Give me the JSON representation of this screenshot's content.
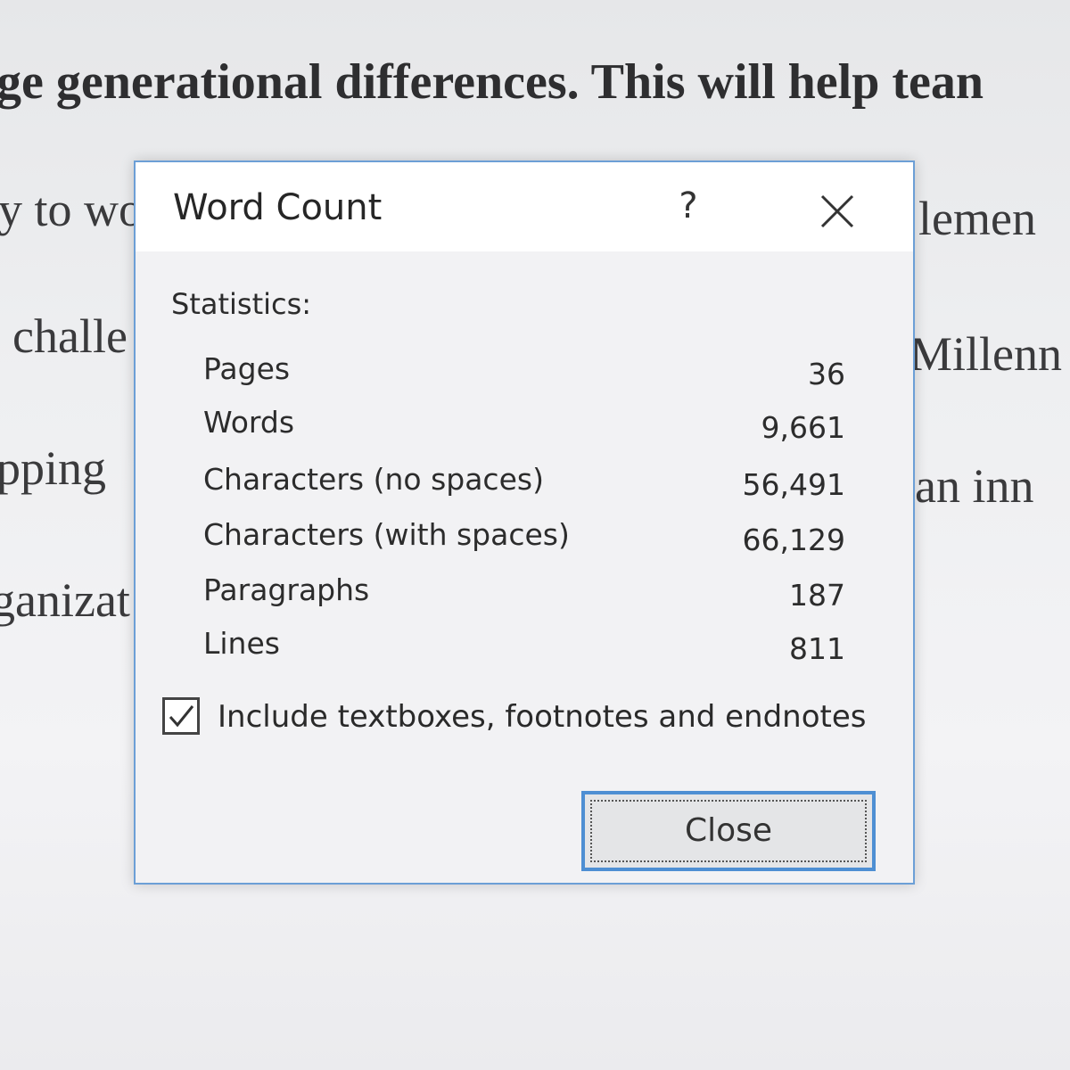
{
  "document": {
    "lines": [
      "ge generational differences. This will help tean",
      "y to wo",
      "lemen",
      "challe",
      "Millenn",
      "pping",
      "an inn",
      "ganizat"
    ]
  },
  "dialog": {
    "title": "Word Count",
    "help_label": "?",
    "section_label": "Statistics:",
    "stats": [
      {
        "label": "Pages",
        "value": "36"
      },
      {
        "label": "Words",
        "value": "9,661"
      },
      {
        "label": "Characters (no spaces)",
        "value": "56,491"
      },
      {
        "label": "Characters (with spaces)",
        "value": "66,129"
      },
      {
        "label": "Paragraphs",
        "value": "187"
      },
      {
        "label": "Lines",
        "value": "811"
      }
    ],
    "checkbox": {
      "label": "Include textboxes, footnotes and endnotes",
      "checked": true
    },
    "close_label": "Close",
    "icons": {
      "close": "close-icon",
      "check": "checkmark-icon"
    },
    "colors": {
      "border": "#6c9fd6",
      "focus": "#4e8fd3"
    }
  }
}
